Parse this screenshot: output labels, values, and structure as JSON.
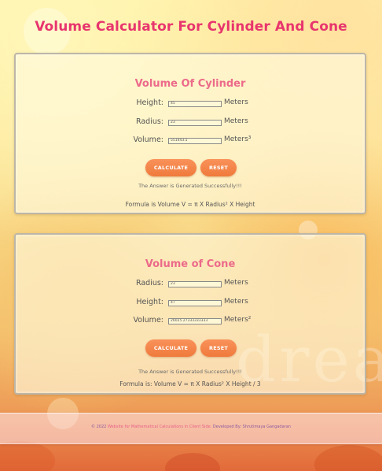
{
  "page": {
    "title": "Volume Calculator For Cylinder And Cone"
  },
  "cylinder": {
    "title": "Volume Of Cylinder",
    "height": {
      "label": "Height:",
      "value": "45",
      "unit": "Meters"
    },
    "radius": {
      "label": "Radius:",
      "value": "23",
      "unit": "Meters"
    },
    "volume": {
      "label": "Volume:",
      "value": "551443.5",
      "unit": "Meters³"
    },
    "calculate_label": "CALCULATE",
    "reset_label": "RESET",
    "status": "The Answer is Generated Successfully!!!",
    "formula": "Formula is Volume V = π X Radius² X Height"
  },
  "cone": {
    "title": "Volume of Cone",
    "radius": {
      "label": "Radius:",
      "value": "23",
      "unit": "Meters"
    },
    "height": {
      "label": "Height:",
      "value": "47",
      "unit": "Meters"
    },
    "volume": {
      "label": "Volume:",
      "value": "26025.27333333333",
      "unit": "Meters²"
    },
    "calculate_label": "CALCULATE",
    "reset_label": "RESET",
    "status": "The Answer is Generated Successfully!!!",
    "formula": "Formula is: Volume V = π X Radius² X Height / 3"
  },
  "footer": {
    "prefix": "© 2022 ",
    "site": "Website for Mathematical Calculations in Client Side.",
    "developer": " Developed By: Shrutimaya Gangadaran"
  },
  "watermark": "dreams",
  "colors": {
    "title": "#e8356e",
    "card_title": "#ec6a8a",
    "button": "#f07a3c",
    "footer_text": "#8d5aa0"
  }
}
